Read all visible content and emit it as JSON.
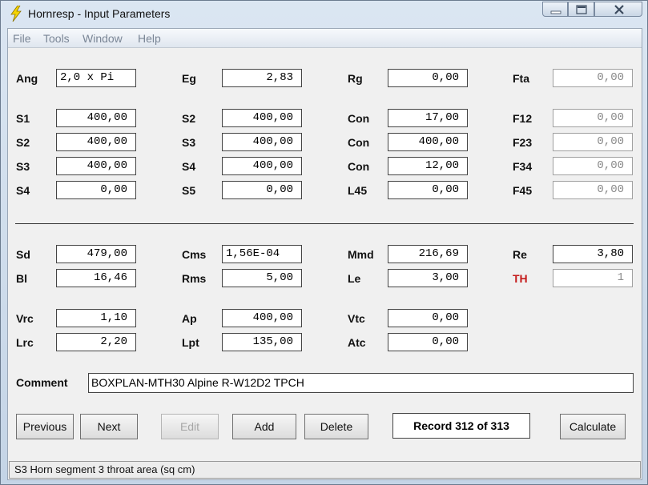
{
  "window": {
    "title": "Hornresp - Input Parameters"
  },
  "menu": [
    "File",
    "Tools",
    "Window",
    "Help"
  ],
  "fields": {
    "ang": {
      "label": "Ang",
      "value": "2,0 x Pi"
    },
    "eg": {
      "label": "Eg",
      "value": "2,83"
    },
    "rg": {
      "label": "Rg",
      "value": "0,00"
    },
    "fta": {
      "label": "Fta",
      "value": "0,00"
    },
    "s1": {
      "label": "S1",
      "value": "400,00"
    },
    "s2a": {
      "label": "S2",
      "value": "400,00"
    },
    "con1": {
      "label": "Con",
      "value": "17,00"
    },
    "f12": {
      "label": "F12",
      "value": "0,00"
    },
    "s2b": {
      "label": "S2",
      "value": "400,00"
    },
    "s3a": {
      "label": "S3",
      "value": "400,00"
    },
    "con2": {
      "label": "Con",
      "value": "400,00"
    },
    "f23": {
      "label": "F23",
      "value": "0,00"
    },
    "s3b": {
      "label": "S3",
      "value": "400,00"
    },
    "s4a": {
      "label": "S4",
      "value": "400,00"
    },
    "con3": {
      "label": "Con",
      "value": "12,00"
    },
    "f34": {
      "label": "F34",
      "value": "0,00"
    },
    "s4b": {
      "label": "S4",
      "value": "0,00"
    },
    "s5": {
      "label": "S5",
      "value": "0,00"
    },
    "l45": {
      "label": "L45",
      "value": "0,00"
    },
    "f45": {
      "label": "F45",
      "value": "0,00"
    },
    "sd": {
      "label": "Sd",
      "value": "479,00"
    },
    "cms": {
      "label": "Cms",
      "value": "1,56E-04"
    },
    "mmd": {
      "label": "Mmd",
      "value": "216,69"
    },
    "re": {
      "label": "Re",
      "value": "3,80"
    },
    "bl": {
      "label": "Bl",
      "value": "16,46"
    },
    "rms": {
      "label": "Rms",
      "value": "5,00"
    },
    "le": {
      "label": "Le",
      "value": "3,00"
    },
    "th": {
      "label": "TH",
      "value": "1"
    },
    "vrc": {
      "label": "Vrc",
      "value": "1,10"
    },
    "ap": {
      "label": "Ap",
      "value": "400,00"
    },
    "vtc": {
      "label": "Vtc",
      "value": "0,00"
    },
    "lrc": {
      "label": "Lrc",
      "value": "2,20"
    },
    "lpt": {
      "label": "Lpt",
      "value": "135,00"
    },
    "atc": {
      "label": "Atc",
      "value": "0,00"
    }
  },
  "comment": {
    "label": "Comment",
    "value": "BOXPLAN-MTH30 Alpine R-W12D2 TPCH"
  },
  "buttons": {
    "previous": "Previous",
    "next": "Next",
    "edit": "Edit",
    "add": "Add",
    "delete": "Delete",
    "calculate": "Calculate"
  },
  "record": "Record 312 of 313",
  "status": "S3  Horn segment 3 throat area  (sq cm)",
  "colors": {
    "th_label": "#c41a1a",
    "icon": "#f5d400"
  }
}
